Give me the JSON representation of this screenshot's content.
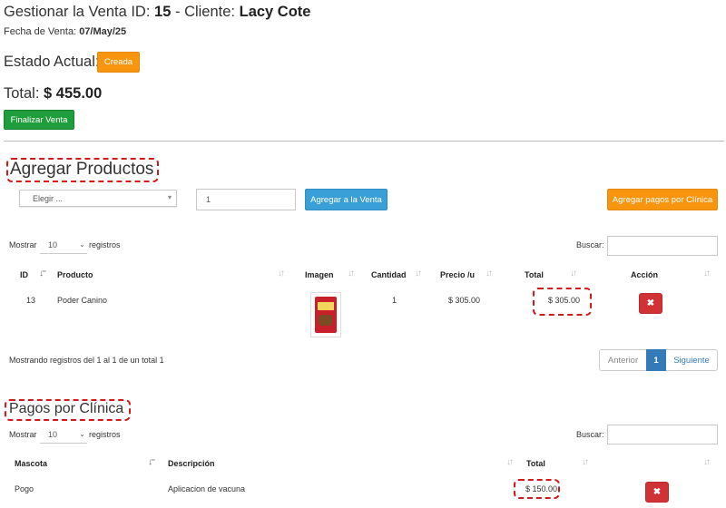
{
  "header": {
    "title_prefix": "Gestionar la Venta ID:",
    "sale_id": "15",
    "client_prefix": "- Cliente:",
    "client_name": "Lacy Cote",
    "date_label": "Fecha de Venta:",
    "date_value": "07/May/25",
    "status_label": "Estado Actual:",
    "status_badge": "Creada",
    "total_label": "Total:",
    "total_value": "$ 455.00",
    "finalize_button": "Finalizar Venta"
  },
  "products_section": {
    "title": "Agregar Productos",
    "select_placeholder": "Elegir ...",
    "quantity_value": "1",
    "add_button": "Agregar a la Venta",
    "add_payments_button": "Agregar pagos por Clínica",
    "show_label": "Mostrar",
    "page_size": "10",
    "records_label": "registros",
    "search_label": "Buscar:",
    "columns": [
      "ID",
      "Producto",
      "Imagen",
      "Cantidad",
      "Precio /u",
      "Total",
      "Acción"
    ],
    "rows": [
      {
        "id": "13",
        "product": "Poder Canino",
        "quantity": "1",
        "unit_price": "$ 305.00",
        "total": "$ 305.00"
      }
    ],
    "info": "Mostrando registros del 1 al 1 de un total 1",
    "pagination": {
      "prev": "Anterior",
      "current": "1",
      "next": "Siguiente"
    }
  },
  "payments_section": {
    "title": "Pagos por Clínica",
    "show_label": "Mostrar",
    "page_size": "10",
    "records_label": "registros",
    "search_label": "Buscar:",
    "columns": [
      "Mascota",
      "Descripción",
      "Total"
    ],
    "rows": [
      {
        "pet": "Pogo",
        "description": "Aplicacion de vacuna",
        "total": "$ 150.00"
      }
    ]
  },
  "icons": {
    "delete": "close-icon",
    "sort": "sort-arrows-icon"
  },
  "colors": {
    "status_badge": "#f8950f",
    "finalize": "#1f9c3b",
    "add_button": "#3a9fd6",
    "delete": "#d03236",
    "highlight": "#d21a1a",
    "pagination_active": "#337ab7"
  }
}
